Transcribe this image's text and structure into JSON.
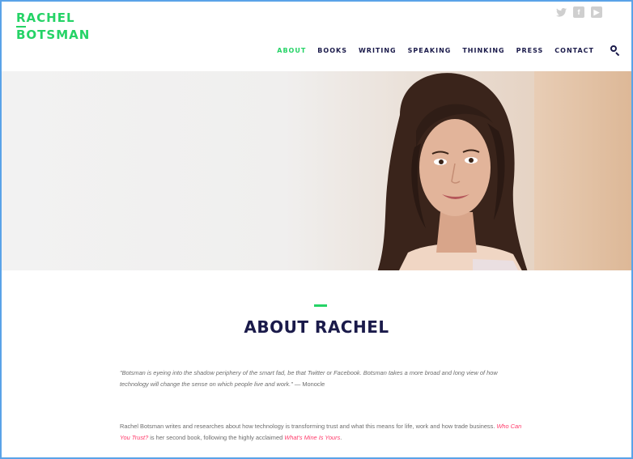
{
  "logo": {
    "line1": "RACHEL",
    "line2": "BOTSMAN"
  },
  "social_icons": [
    "twitter-icon",
    "facebook-icon",
    "youtube-icon",
    "instagram-icon"
  ],
  "nav": {
    "items": [
      {
        "label": "ABOUT",
        "active": true
      },
      {
        "label": "BOOKS",
        "active": false
      },
      {
        "label": "WRITING",
        "active": false
      },
      {
        "label": "SPEAKING",
        "active": false
      },
      {
        "label": "THINKING",
        "active": false
      },
      {
        "label": "PRESS",
        "active": false
      },
      {
        "label": "CONTACT",
        "active": false
      }
    ],
    "search_icon": "search-icon"
  },
  "hero": {
    "image": "portrait-photo"
  },
  "about": {
    "title": "ABOUT RACHEL",
    "quote": "\"Botsman is eyeing into the shadow periphery of the smart fad, be that Twitter or Facebook. Botsman takes a more broad and long view of how technology will change the sense on which people live and work.\"",
    "quote_source": "— Monocle",
    "bio_text": "Rachel Botsman writes and researches about how technology is transforming trust and what this means for life, work and how trade business. ",
    "bio_link1": "Who Can You Trust?",
    "bio_mid": " is her second book, following the highly acclaimed ",
    "bio_link2": "What's Mine Is Yours",
    "bio_end": "."
  },
  "colors": {
    "accent_green": "#25d366",
    "navy": "#1a1a4a",
    "link_pink": "#ff3a6a",
    "frame_blue": "#5aa3e8"
  }
}
